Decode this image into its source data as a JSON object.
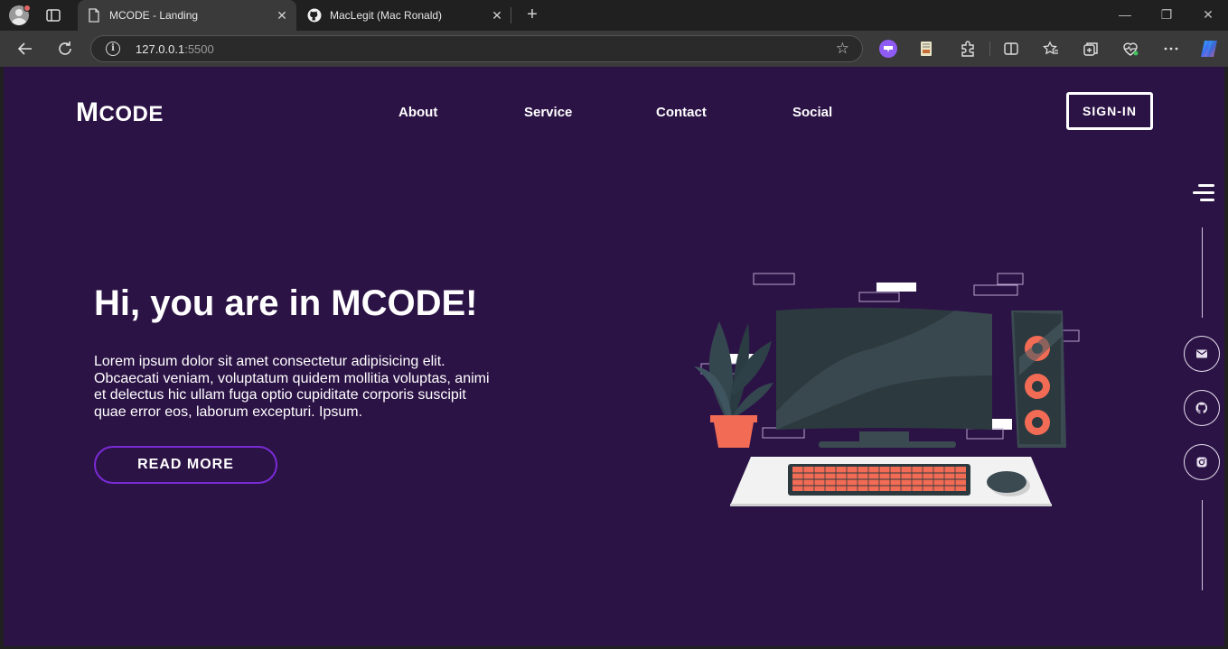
{
  "browser": {
    "tabs": [
      {
        "title": "MCODE - Landing",
        "active": true
      },
      {
        "title": "MacLegit (Mac Ronald)",
        "active": false
      }
    ],
    "url_host": "127.0.0.1",
    "url_port": ":5500"
  },
  "site": {
    "logo_first": "M",
    "logo_rest": "CODE",
    "nav": [
      "About",
      "Service",
      "Contact",
      "Social"
    ],
    "signin_label": "SIGN-IN",
    "hero": {
      "title": "Hi, you are in MCODE!",
      "text": "Lorem ipsum dolor sit amet consectetur adipisicing elit. Obcaecati veniam, voluptatum quidem mollitia voluptas, animi et delectus hic ullam fuga optio cupiditate corporis suscipit quae error eos, laborum excepturi. Ipsum.",
      "cta_label": "READ MORE"
    },
    "social_icons": [
      "mail-icon",
      "github-icon",
      "instagram-icon"
    ]
  },
  "colors": {
    "page_bg": "#2c1346",
    "accent": "#7a2bd6",
    "illustration_accent": "#f26b55"
  }
}
